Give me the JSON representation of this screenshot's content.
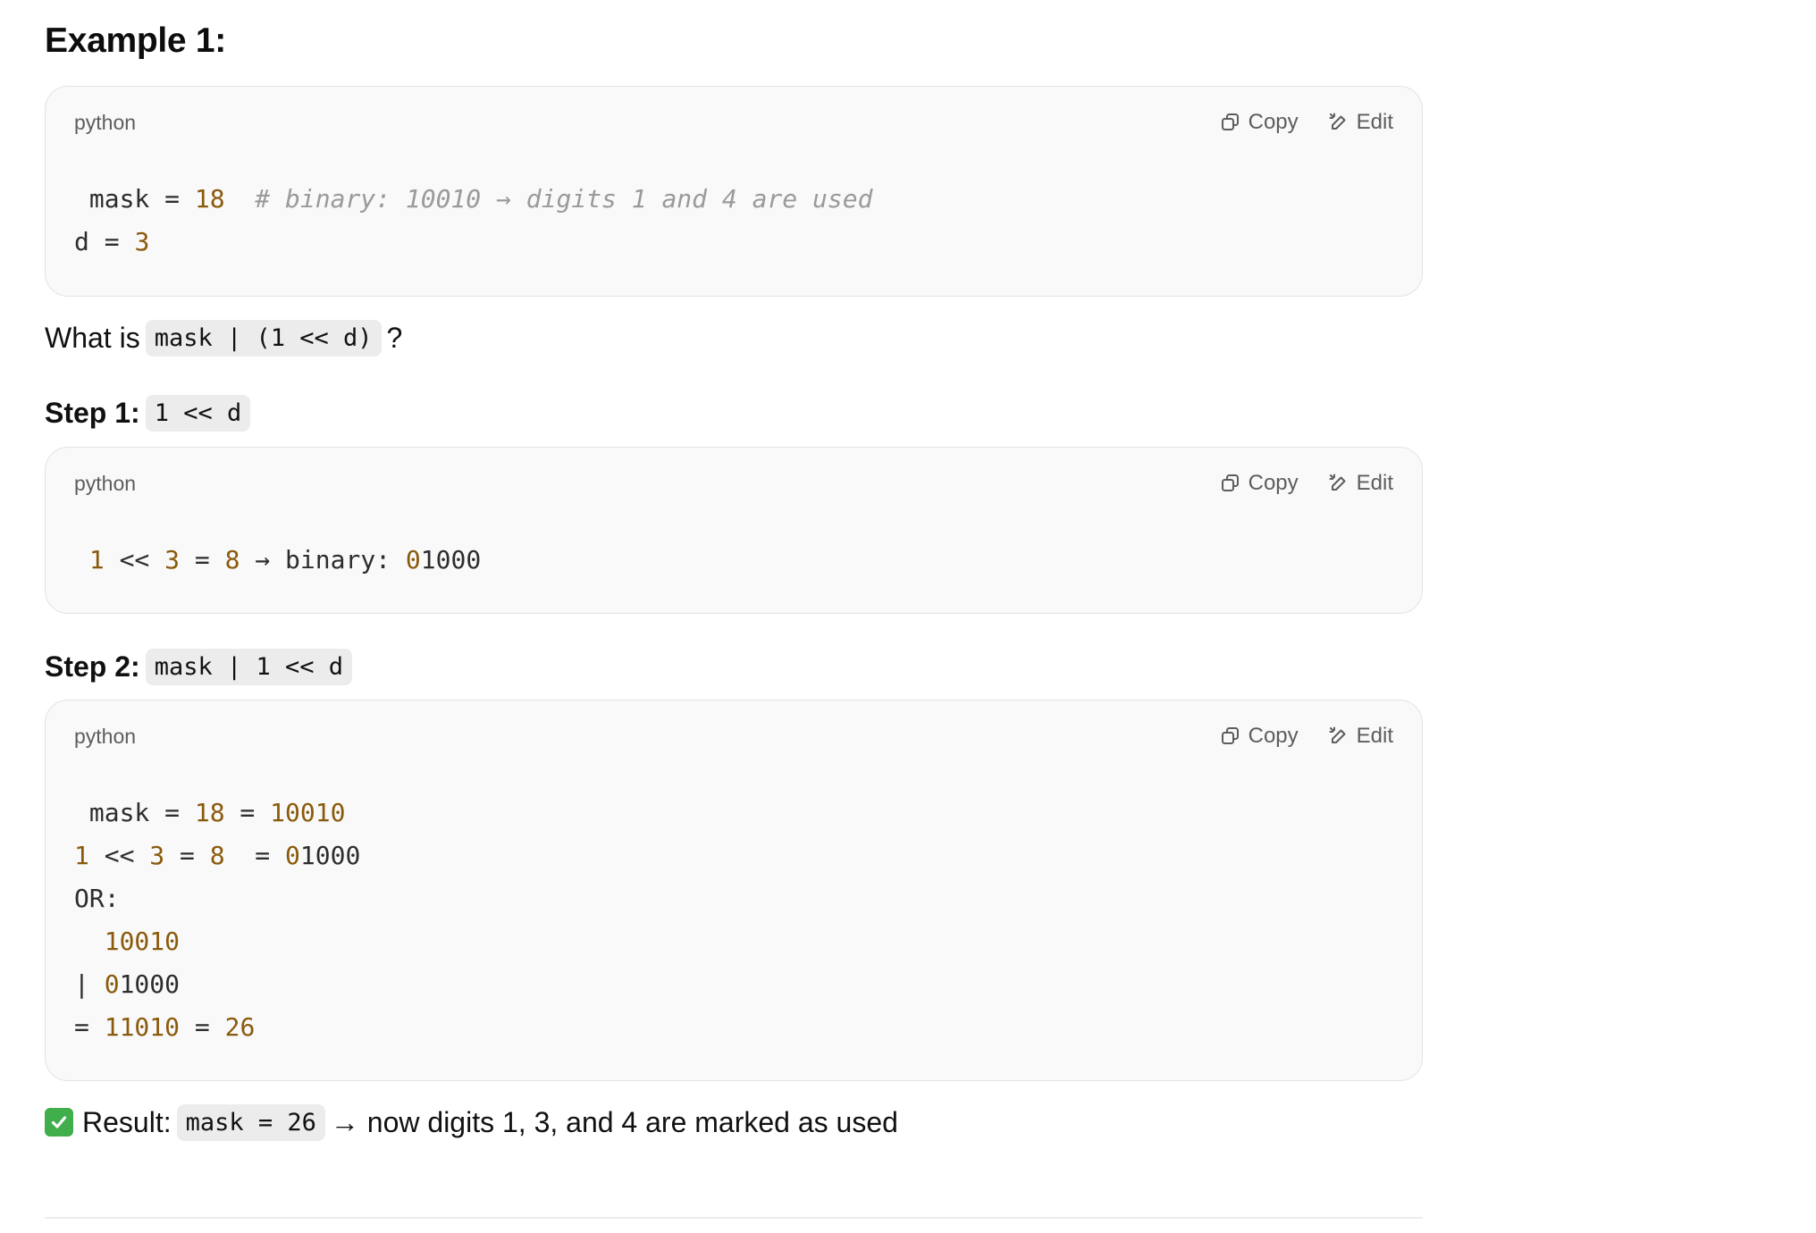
{
  "example_heading": "Example 1:",
  "code_block_1": {
    "language": "python",
    "copy_label": "Copy",
    "edit_label": "Edit"
  },
  "code_block_2": {
    "language": "python",
    "copy_label": "Copy",
    "edit_label": "Edit"
  },
  "code_block_3": {
    "language": "python",
    "copy_label": "Copy",
    "edit_label": "Edit"
  },
  "question": {
    "prefix": "What is",
    "code": "mask | (1 << d)",
    "suffix": "?"
  },
  "step1": {
    "label": "Step 1:",
    "code": "1 << d"
  },
  "step2": {
    "label": "Step 2:",
    "code": "mask | 1 << d"
  },
  "result": {
    "label": "Result:",
    "code": "mask = 26",
    "suffix": "→ now digits 1, 3, and 4 are marked as used"
  },
  "icons": {
    "copy": "copy-icon",
    "edit": "edit-icon",
    "check": "check-mark-icon"
  },
  "colors": {
    "code_background": "#f9f9f9",
    "number": "#8a5a0c",
    "comment": "#9a9a9a",
    "check_green": "#3fae4b"
  }
}
